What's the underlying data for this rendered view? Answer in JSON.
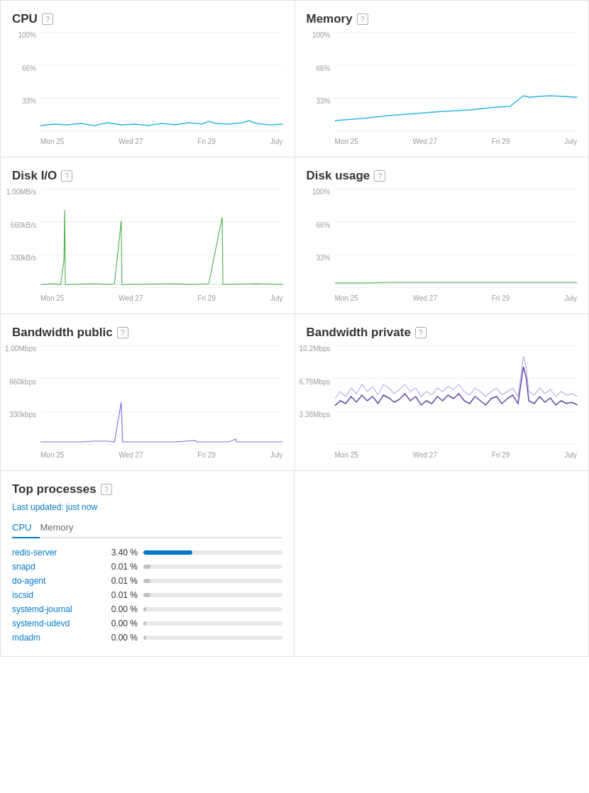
{
  "panels": {
    "cpu": {
      "title": "CPU",
      "yLabels": [
        "100%",
        "66%",
        "33%"
      ],
      "xLabels": [
        "Mon 25",
        "Wed 27",
        "Fri 29",
        "July"
      ],
      "chartType": "cpu"
    },
    "memory": {
      "title": "Memory",
      "yLabels": [
        "100%",
        "66%",
        "33%"
      ],
      "xLabels": [
        "Mon 25",
        "Wed 27",
        "Fri 29",
        "July"
      ],
      "chartType": "memory"
    },
    "diskio": {
      "title": "Disk I/O",
      "yLabels": [
        "1.00MB/s",
        "660kB/s",
        "330kB/s"
      ],
      "xLabels": [
        "Mon 25",
        "Wed 27",
        "Fri 29",
        "July"
      ],
      "chartType": "diskio"
    },
    "diskusage": {
      "title": "Disk usage",
      "yLabels": [
        "100%",
        "66%",
        "33%"
      ],
      "xLabels": [
        "Mon 25",
        "Wed 27",
        "Fri 29",
        "July"
      ],
      "chartType": "diskusage"
    },
    "bwpublic": {
      "title": "Bandwidth public",
      "yLabels": [
        "1.00Mbps",
        "660kbps",
        "330kbps"
      ],
      "xLabels": [
        "Mon 25",
        "Wed 27",
        "Fri 29",
        "July"
      ],
      "chartType": "bwpublic"
    },
    "bwprivate": {
      "title": "Bandwidth private",
      "yLabels": [
        "10.2Mbps",
        "6.75Mbps",
        "3.38Mbps"
      ],
      "xLabels": [
        "Mon 25",
        "Wed 27",
        "Fri 29",
        "July"
      ],
      "chartType": "bwprivate"
    }
  },
  "topProcesses": {
    "title": "Top processes",
    "lastUpdated": "Last updated:",
    "lastUpdatedTime": "just now",
    "tabs": [
      "CPU",
      "Memory"
    ],
    "activeTab": "CPU",
    "processes": [
      {
        "name": "redis-server",
        "pct": "3.40 %",
        "barWidth": 35,
        "barColor": "blue"
      },
      {
        "name": "snapd",
        "pct": "0.01 %",
        "barWidth": 5,
        "barColor": "gray"
      },
      {
        "name": "do-agent",
        "pct": "0.01 %",
        "barWidth": 5,
        "barColor": "gray"
      },
      {
        "name": "iscsid",
        "pct": "0.01 %",
        "barWidth": 5,
        "barColor": "gray"
      },
      {
        "name": "systemd-journal",
        "pct": "0.00 %",
        "barWidth": 2,
        "barColor": "gray"
      },
      {
        "name": "systemd-udevd",
        "pct": "0.00 %",
        "barWidth": 2,
        "barColor": "gray"
      },
      {
        "name": "mdadm",
        "pct": "0.00 %",
        "barWidth": 2,
        "barColor": "gray"
      }
    ]
  }
}
